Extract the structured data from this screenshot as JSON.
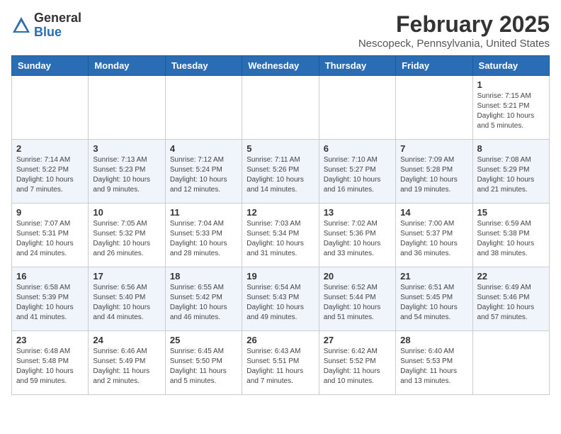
{
  "logo": {
    "general": "General",
    "blue": "Blue"
  },
  "title": "February 2025",
  "subtitle": "Nescopeck, Pennsylvania, United States",
  "weekdays": [
    "Sunday",
    "Monday",
    "Tuesday",
    "Wednesday",
    "Thursday",
    "Friday",
    "Saturday"
  ],
  "weeks": [
    [
      {
        "day": "",
        "detail": ""
      },
      {
        "day": "",
        "detail": ""
      },
      {
        "day": "",
        "detail": ""
      },
      {
        "day": "",
        "detail": ""
      },
      {
        "day": "",
        "detail": ""
      },
      {
        "day": "",
        "detail": ""
      },
      {
        "day": "1",
        "detail": "Sunrise: 7:15 AM\nSunset: 5:21 PM\nDaylight: 10 hours\nand 5 minutes."
      }
    ],
    [
      {
        "day": "2",
        "detail": "Sunrise: 7:14 AM\nSunset: 5:22 PM\nDaylight: 10 hours\nand 7 minutes."
      },
      {
        "day": "3",
        "detail": "Sunrise: 7:13 AM\nSunset: 5:23 PM\nDaylight: 10 hours\nand 9 minutes."
      },
      {
        "day": "4",
        "detail": "Sunrise: 7:12 AM\nSunset: 5:24 PM\nDaylight: 10 hours\nand 12 minutes."
      },
      {
        "day": "5",
        "detail": "Sunrise: 7:11 AM\nSunset: 5:26 PM\nDaylight: 10 hours\nand 14 minutes."
      },
      {
        "day": "6",
        "detail": "Sunrise: 7:10 AM\nSunset: 5:27 PM\nDaylight: 10 hours\nand 16 minutes."
      },
      {
        "day": "7",
        "detail": "Sunrise: 7:09 AM\nSunset: 5:28 PM\nDaylight: 10 hours\nand 19 minutes."
      },
      {
        "day": "8",
        "detail": "Sunrise: 7:08 AM\nSunset: 5:29 PM\nDaylight: 10 hours\nand 21 minutes."
      }
    ],
    [
      {
        "day": "9",
        "detail": "Sunrise: 7:07 AM\nSunset: 5:31 PM\nDaylight: 10 hours\nand 24 minutes."
      },
      {
        "day": "10",
        "detail": "Sunrise: 7:05 AM\nSunset: 5:32 PM\nDaylight: 10 hours\nand 26 minutes."
      },
      {
        "day": "11",
        "detail": "Sunrise: 7:04 AM\nSunset: 5:33 PM\nDaylight: 10 hours\nand 28 minutes."
      },
      {
        "day": "12",
        "detail": "Sunrise: 7:03 AM\nSunset: 5:34 PM\nDaylight: 10 hours\nand 31 minutes."
      },
      {
        "day": "13",
        "detail": "Sunrise: 7:02 AM\nSunset: 5:36 PM\nDaylight: 10 hours\nand 33 minutes."
      },
      {
        "day": "14",
        "detail": "Sunrise: 7:00 AM\nSunset: 5:37 PM\nDaylight: 10 hours\nand 36 minutes."
      },
      {
        "day": "15",
        "detail": "Sunrise: 6:59 AM\nSunset: 5:38 PM\nDaylight: 10 hours\nand 38 minutes."
      }
    ],
    [
      {
        "day": "16",
        "detail": "Sunrise: 6:58 AM\nSunset: 5:39 PM\nDaylight: 10 hours\nand 41 minutes."
      },
      {
        "day": "17",
        "detail": "Sunrise: 6:56 AM\nSunset: 5:40 PM\nDaylight: 10 hours\nand 44 minutes."
      },
      {
        "day": "18",
        "detail": "Sunrise: 6:55 AM\nSunset: 5:42 PM\nDaylight: 10 hours\nand 46 minutes."
      },
      {
        "day": "19",
        "detail": "Sunrise: 6:54 AM\nSunset: 5:43 PM\nDaylight: 10 hours\nand 49 minutes."
      },
      {
        "day": "20",
        "detail": "Sunrise: 6:52 AM\nSunset: 5:44 PM\nDaylight: 10 hours\nand 51 minutes."
      },
      {
        "day": "21",
        "detail": "Sunrise: 6:51 AM\nSunset: 5:45 PM\nDaylight: 10 hours\nand 54 minutes."
      },
      {
        "day": "22",
        "detail": "Sunrise: 6:49 AM\nSunset: 5:46 PM\nDaylight: 10 hours\nand 57 minutes."
      }
    ],
    [
      {
        "day": "23",
        "detail": "Sunrise: 6:48 AM\nSunset: 5:48 PM\nDaylight: 10 hours\nand 59 minutes."
      },
      {
        "day": "24",
        "detail": "Sunrise: 6:46 AM\nSunset: 5:49 PM\nDaylight: 11 hours\nand 2 minutes."
      },
      {
        "day": "25",
        "detail": "Sunrise: 6:45 AM\nSunset: 5:50 PM\nDaylight: 11 hours\nand 5 minutes."
      },
      {
        "day": "26",
        "detail": "Sunrise: 6:43 AM\nSunset: 5:51 PM\nDaylight: 11 hours\nand 7 minutes."
      },
      {
        "day": "27",
        "detail": "Sunrise: 6:42 AM\nSunset: 5:52 PM\nDaylight: 11 hours\nand 10 minutes."
      },
      {
        "day": "28",
        "detail": "Sunrise: 6:40 AM\nSunset: 5:53 PM\nDaylight: 11 hours\nand 13 minutes."
      },
      {
        "day": "",
        "detail": ""
      }
    ]
  ]
}
